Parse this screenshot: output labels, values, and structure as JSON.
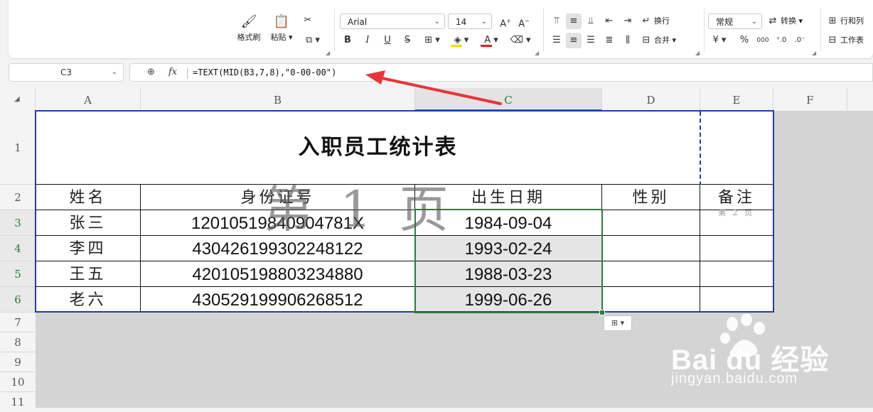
{
  "ribbon": {
    "format_painter": "格式刷",
    "paste": "粘贴",
    "font_name": "Arial",
    "font_size": "14",
    "wrap_text": "换行",
    "merge": "合并",
    "number_format": "常规",
    "convert": "转换",
    "row_col": "行和列",
    "worksheet": "工作表",
    "currency": "¥",
    "percent": "%",
    "thousands": "000",
    "bold": "B",
    "italic": "I",
    "underline": "U",
    "strike": "S",
    "font_color": "#e02020",
    "fill_color": "#f5e000"
  },
  "formula_bar": {
    "name_box": "C3",
    "formula": "=TEXT(MID(B3,7,8),\"0-00-00\")"
  },
  "columns": [
    "A",
    "B",
    "C",
    "D",
    "E",
    "F"
  ],
  "rows": [
    "1",
    "2",
    "3",
    "4",
    "5",
    "6",
    "7",
    "8",
    "9",
    "10",
    "11"
  ],
  "table": {
    "title": "入职员工统计表",
    "headers": [
      "姓名",
      "身份证号",
      "出生日期",
      "性别",
      "备注"
    ],
    "data": [
      {
        "name": "张三",
        "id": "12010519840904781X",
        "birth": "1984-09-04"
      },
      {
        "name": "李四",
        "id": "430426199302248122",
        "birth": "1993-02-24"
      },
      {
        "name": "王五",
        "id": "420105198803234880",
        "birth": "1988-03-23"
      },
      {
        "name": "老六",
        "id": "430529199906268512",
        "birth": "1999-06-26"
      }
    ]
  },
  "page_watermark_1": "第 1 页",
  "page_watermark_2": "第 2 页",
  "baidu_logo": "Bai du 经验",
  "baidu_url": "jingyan.baidu.com",
  "annotation_color": "#e8343a",
  "selection_color": "#2c7c3e",
  "print_border_color": "#1f3fa8"
}
